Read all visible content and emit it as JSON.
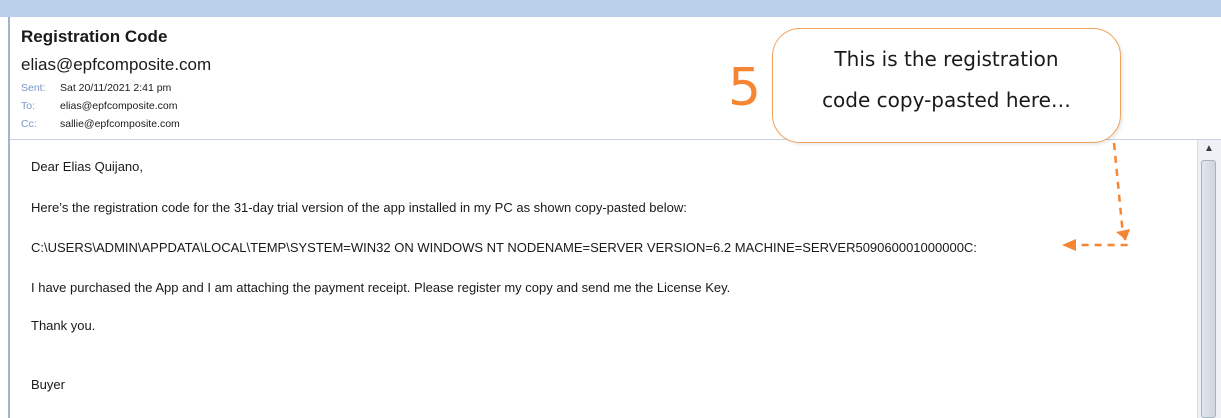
{
  "email": {
    "subject": "Registration Code",
    "sender": "elias@epfcomposite.com",
    "meta": {
      "sent_label": "Sent:",
      "sent_value": "Sat 20/11/2021 2:41 pm",
      "to_label": "To:",
      "to_value": "elias@epfcomposite.com",
      "cc_label": "Cc:",
      "cc_value": "sallie@epfcomposite.com"
    },
    "body": {
      "greeting": "Dear Elias Quijano,",
      "intro": "Here’s the registration code for the 31-day trial  version of the app installed in my PC as shown copy-pasted below:",
      "code": "C:\\USERS\\ADMIN\\APPDATA\\LOCAL\\TEMP\\SYSTEM=WIN32 ON WINDOWS NT NODENAME=SERVER VERSION=6.2 MACHINE=SERVER509060001000000C:",
      "purchase": "I have purchased the App and I am attaching the payment receipt. Please register my copy and send me the License Key.",
      "thanks": "Thank you.",
      "signature": "Buyer"
    }
  },
  "annotation": {
    "step_number": "5",
    "callout_line1": "This is the registration",
    "callout_line2": "code copy-pasted here…",
    "accent_color": "#f58634"
  },
  "scrollbar": {
    "up_icon": "scroll-up-arrow-icon"
  }
}
